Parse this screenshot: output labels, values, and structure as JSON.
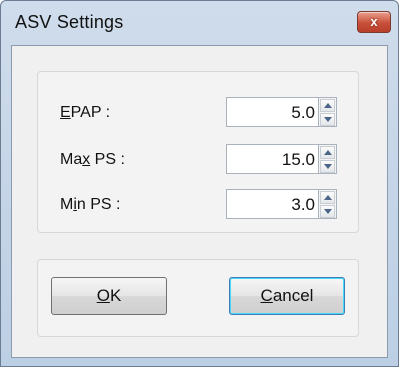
{
  "window": {
    "title": "ASV Settings",
    "close_glyph": "x"
  },
  "fields": [
    {
      "label_pre": "",
      "label_accel": "E",
      "label_post": "PAP :",
      "value": "5.0"
    },
    {
      "label_pre": "Ma",
      "label_accel": "x",
      "label_post": " PS :",
      "value": "15.0"
    },
    {
      "label_pre": "M",
      "label_accel": "i",
      "label_post": "n PS :",
      "value": "3.0"
    }
  ],
  "buttons": {
    "ok": {
      "accel": "O",
      "rest": "K"
    },
    "cancel": {
      "accel": "C",
      "rest": "ancel"
    }
  },
  "colors": {
    "accent_focus": "#3c7fb1",
    "close_button": "#c8503a"
  }
}
